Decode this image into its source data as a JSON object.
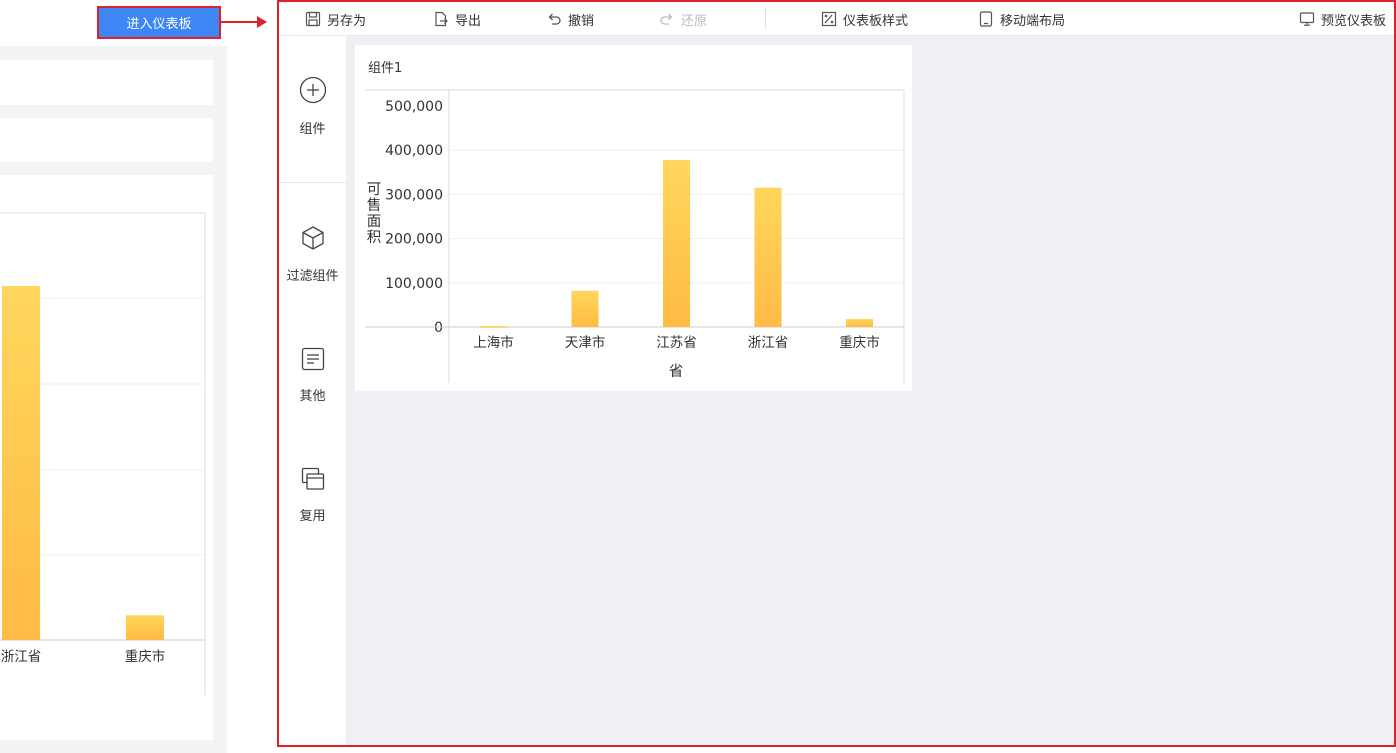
{
  "left_panel": {
    "chart_data": {
      "type": "bar",
      "categories": [
        "浙江省",
        "重庆市"
      ],
      "values": [
        315000,
        22000
      ],
      "ylim": [
        0,
        380000
      ]
    }
  },
  "enter_button": {
    "label": "进入仪表板"
  },
  "toolbar": {
    "save_as": "另存为",
    "export": "导出",
    "undo": "撤销",
    "redo": "还原",
    "dashboard_style": "仪表板样式",
    "mobile_layout": "移动端布局",
    "preview": "预览仪表板"
  },
  "sidebar": {
    "items": [
      {
        "label": "组件",
        "icon": "add-circle-icon"
      },
      {
        "label": "过滤组件",
        "icon": "cube-icon"
      },
      {
        "label": "其他",
        "icon": "text-box-icon"
      },
      {
        "label": "复用",
        "icon": "copy-window-icon"
      }
    ]
  },
  "widget": {
    "title": "组件1",
    "chart_data": {
      "type": "bar",
      "categories": [
        "上海市",
        "天津市",
        "江苏省",
        "浙江省",
        "重庆市"
      ],
      "values": [
        2000,
        82000,
        378000,
        315000,
        18000
      ],
      "xlabel": "省",
      "ylabel": "可售面积",
      "ylim": [
        0,
        500000
      ],
      "yticks": [
        "0",
        "100,000",
        "200,000",
        "300,000",
        "400,000",
        "500,000"
      ],
      "grid": true,
      "bar_color": "#ffc84a"
    }
  }
}
